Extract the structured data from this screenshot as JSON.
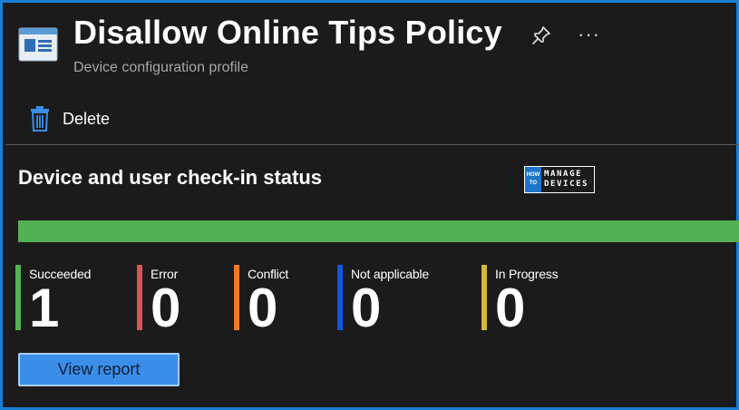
{
  "header": {
    "title": "Disallow Online Tips Policy",
    "subtitle": "Device configuration profile",
    "more_label": "···"
  },
  "toolbar": {
    "delete_label": "Delete"
  },
  "section": {
    "title": "Device and user check-in status"
  },
  "watermark": {
    "left_top": "HOW",
    "left_bottom": "TO",
    "right_top": "MANAGE",
    "right_bottom": "DEVICES"
  },
  "status_bar": {
    "succeeded_fraction": 1.0,
    "color": "#54b054"
  },
  "stats": [
    {
      "label": "Succeeded",
      "value": "1",
      "color": "#54b054"
    },
    {
      "label": "Error",
      "value": "0",
      "color": "#d9545a"
    },
    {
      "label": "Conflict",
      "value": "0",
      "color": "#f07a2a"
    },
    {
      "label": "Not applicable",
      "value": "0",
      "color": "#1355e0"
    },
    {
      "label": "In Progress",
      "value": "0",
      "color": "#d4b73c"
    }
  ],
  "actions": {
    "view_report_label": "View report"
  },
  "colors": {
    "accent": "#1a7fd4",
    "button": "#3a8ee8",
    "background": "#1b1b1b"
  }
}
